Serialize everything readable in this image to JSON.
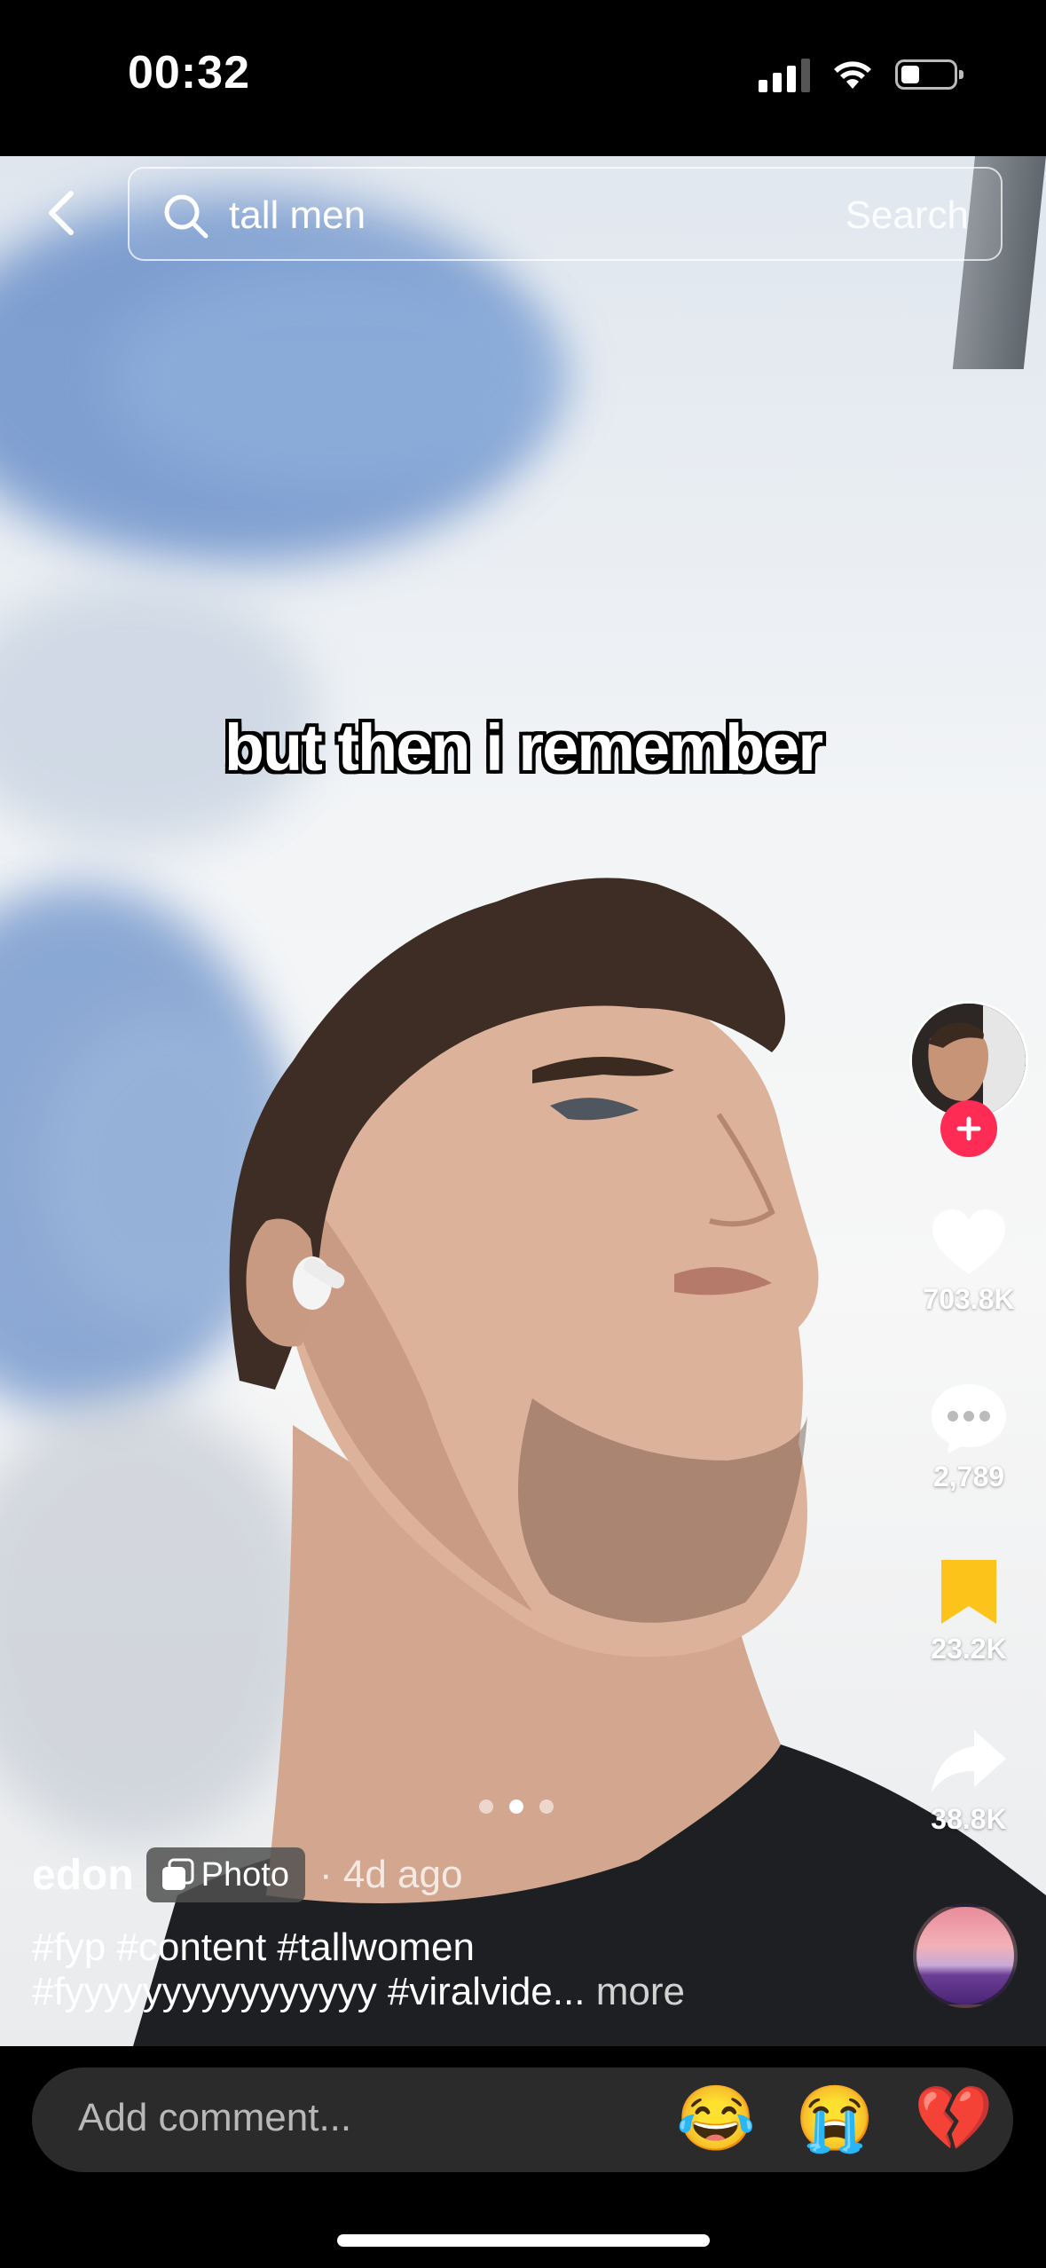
{
  "status_bar": {
    "time": "00:32"
  },
  "search": {
    "query": "tall men",
    "button_label": "Search"
  },
  "video": {
    "caption": "but then i remember"
  },
  "actions": {
    "likes": "703.8K",
    "comments": "2,789",
    "saves": "23.2K",
    "shares": "38.8K"
  },
  "carousel": {
    "total": 3,
    "active_index": 1
  },
  "post": {
    "username": "edon",
    "type_label": "Photo",
    "age": "· 4d ago",
    "description_line1": "#fyp #content #tallwomen",
    "description_line2": "#fyyyyyyyyyyyyyyyy #viralvide...",
    "more_label": "more"
  },
  "comment_bar": {
    "placeholder": "Add comment...",
    "emojis": [
      "😂",
      "😭",
      "💔"
    ]
  },
  "colors": {
    "follow_accent": "#fe2c55",
    "save_active": "#fcc41a"
  }
}
